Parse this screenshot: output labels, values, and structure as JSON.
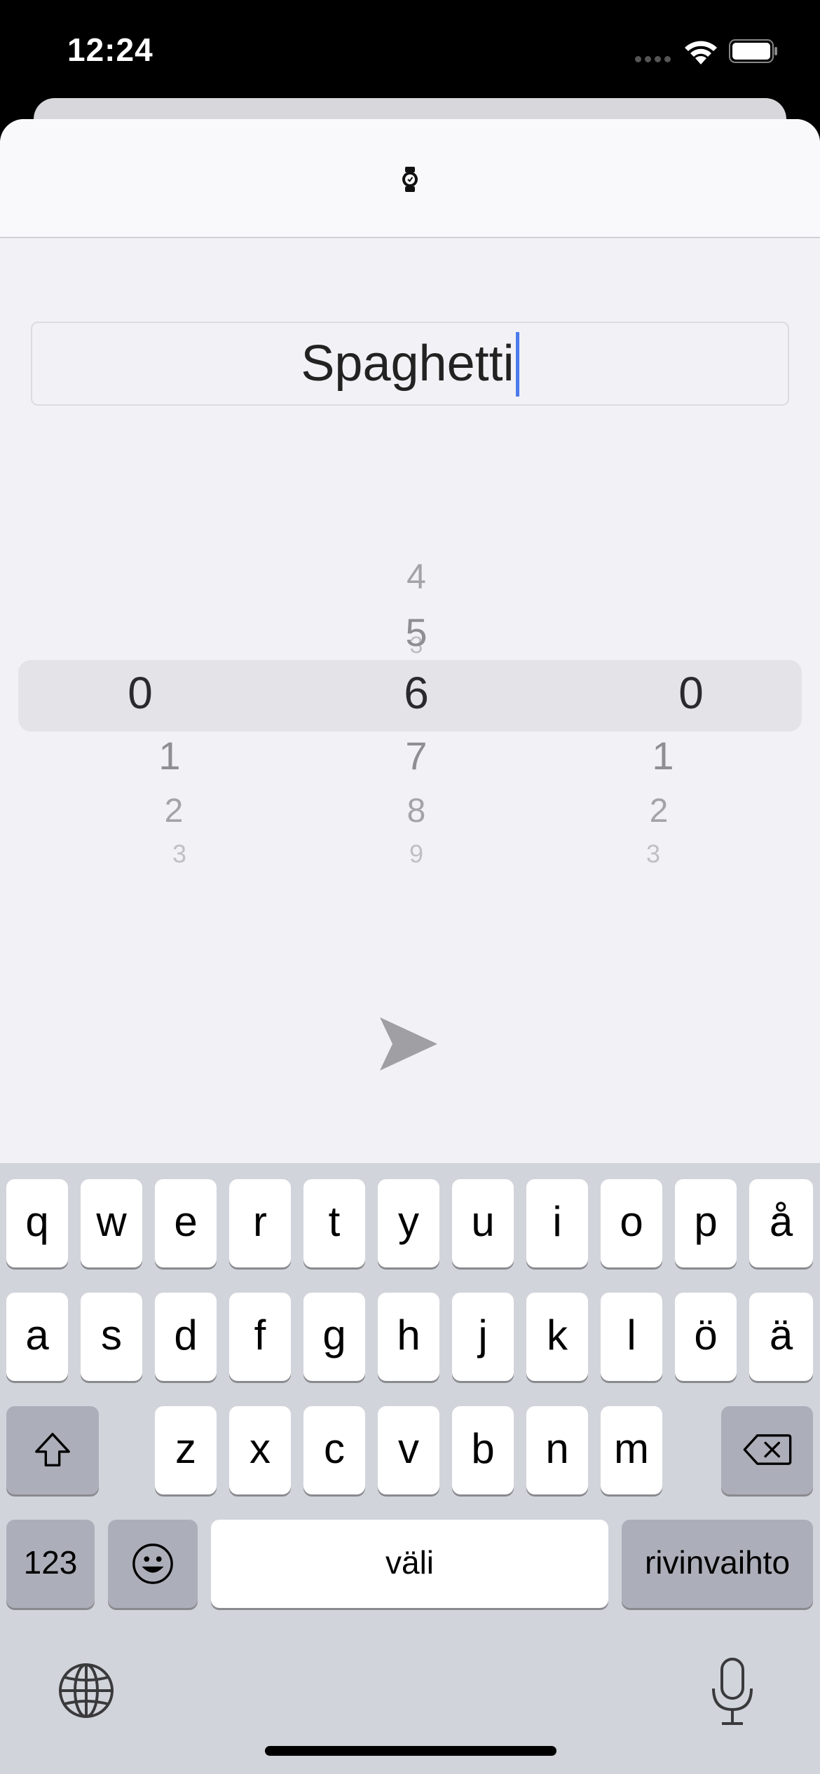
{
  "status_bar": {
    "time": "12:24"
  },
  "form": {
    "name_value": "Spaghetti"
  },
  "picker": {
    "columns": [
      {
        "selected": "0",
        "visible_values": [
          "0",
          "1",
          "2",
          "3"
        ]
      },
      {
        "selected": "6",
        "visible_values": [
          "3",
          "4",
          "5",
          "6",
          "7",
          "8",
          "9"
        ]
      },
      {
        "selected": "0",
        "visible_values": [
          "0",
          "1",
          "2",
          "3"
        ]
      }
    ]
  },
  "keyboard": {
    "row1": [
      "q",
      "w",
      "e",
      "r",
      "t",
      "y",
      "u",
      "i",
      "o",
      "p",
      "å"
    ],
    "row2": [
      "a",
      "s",
      "d",
      "f",
      "g",
      "h",
      "j",
      "k",
      "l",
      "ö",
      "ä"
    ],
    "row3": [
      "z",
      "x",
      "c",
      "v",
      "b",
      "n",
      "m"
    ],
    "numbers_label": "123",
    "space_label": "väli",
    "return_label": "rivinvaihto"
  },
  "icons": {
    "header": "watch-icon",
    "send": "send-icon",
    "shift": "shift-icon",
    "delete": "delete-icon",
    "emoji": "emoji-icon",
    "globe": "globe-icon",
    "mic": "microphone-icon"
  },
  "colors": {
    "cursor": "#4b7bec",
    "sheet_background": "#f2f2f6",
    "keyboard_background": "#d2d4db"
  }
}
